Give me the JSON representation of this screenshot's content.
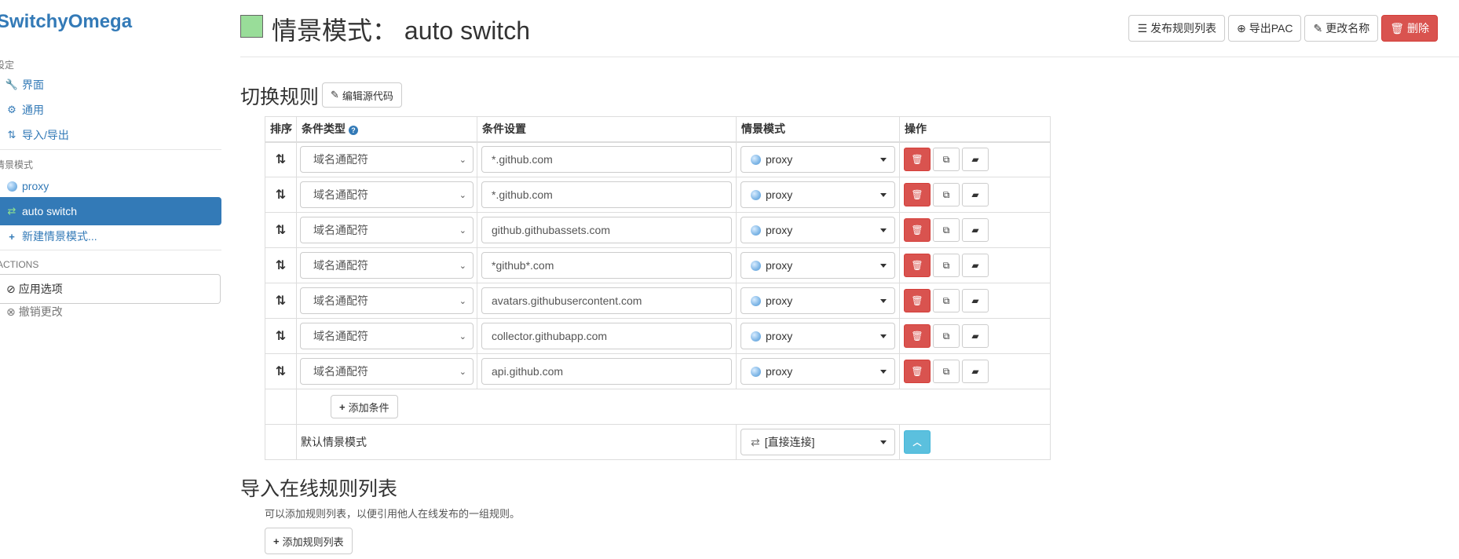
{
  "sidebar": {
    "brand": "SwitchyOmega",
    "settings_header": "设定",
    "settings_items": [
      {
        "label": "界面",
        "icon": "wrench-icon"
      },
      {
        "label": "通用",
        "icon": "gear-icon"
      },
      {
        "label": "导入/导出",
        "icon": "import-export-icon"
      }
    ],
    "profiles_header": "情景模式",
    "profiles": [
      {
        "label": "proxy",
        "icon": "globe-icon",
        "active": false
      },
      {
        "label": "auto switch",
        "icon": "retweet-icon",
        "active": true
      }
    ],
    "new_profile": "新建情景模式...",
    "actions_header": "ACTIONS",
    "apply_button": "应用选项",
    "discard_link": "撤销更改"
  },
  "header": {
    "title_prefix": "情景模式：",
    "title_name": "auto switch",
    "swatch_color": "#99dd99",
    "buttons": {
      "publish": "发布规则列表",
      "export_pac": "导出PAC",
      "rename": "更改名称",
      "delete": "删除"
    }
  },
  "rules_section": {
    "title": "切换规则",
    "edit_source": "编辑源代码",
    "columns": [
      "排序",
      "条件类型",
      "条件设置",
      "情景模式",
      "操作"
    ],
    "rows": [
      {
        "type": "域名通配符",
        "pattern": "*.github.com",
        "profile": "proxy"
      },
      {
        "type": "域名通配符",
        "pattern": "*.github.com",
        "profile": "proxy"
      },
      {
        "type": "域名通配符",
        "pattern": "github.githubassets.com",
        "profile": "proxy"
      },
      {
        "type": "域名通配符",
        "pattern": "*github*.com",
        "profile": "proxy"
      },
      {
        "type": "域名通配符",
        "pattern": "avatars.githubusercontent.com",
        "profile": "proxy"
      },
      {
        "type": "域名通配符",
        "pattern": "collector.githubapp.com",
        "profile": "proxy"
      },
      {
        "type": "域名通配符",
        "pattern": "api.github.com",
        "profile": "proxy"
      }
    ],
    "add_condition": "添加条件",
    "default_label": "默认情景模式",
    "default_profile": "[直接连接]"
  },
  "online_section": {
    "title": "导入在线规则列表",
    "note": "可以添加规则列表，以便引用他人在线发布的一组规则。",
    "add_button": "添加规则列表"
  }
}
